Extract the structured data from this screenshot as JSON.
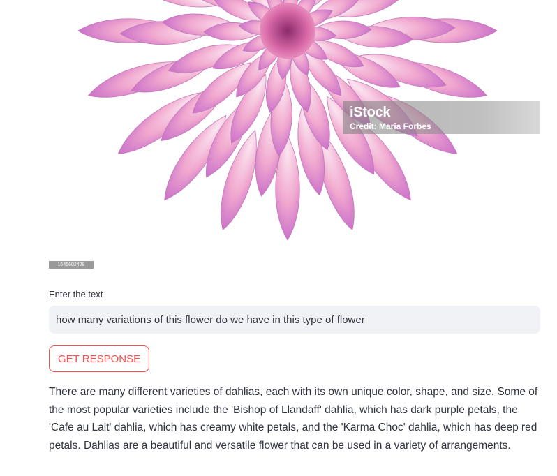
{
  "image": {
    "watermark_brand": "iStock",
    "watermark_credit": "Credit: Maria Forbes",
    "image_id": "1645602428"
  },
  "input": {
    "label": "Enter the text",
    "value": "how many variations of this flower do we have in this type of flower"
  },
  "button": {
    "label": "GET RESPONSE"
  },
  "response": {
    "text": "There are many different varieties of dahlias, each with its own unique color, shape, and size. Some of the most popular varieties include the 'Bishop of Llandaff' dahlia, which has dark purple petals, the 'Cafe au Lait' dahlia, which has creamy white petals, and the 'Karma Choc' dahlia, which has deep red petals. Dahlias are a beautiful and versatile flower that can be used in a variety of arrangements."
  },
  "colors": {
    "accent": "#ff4b4b",
    "input_bg": "#f0f2f6",
    "text": "#31333f",
    "petal_light": "#f6cfe4",
    "petal_dark": "#b65cc4"
  }
}
